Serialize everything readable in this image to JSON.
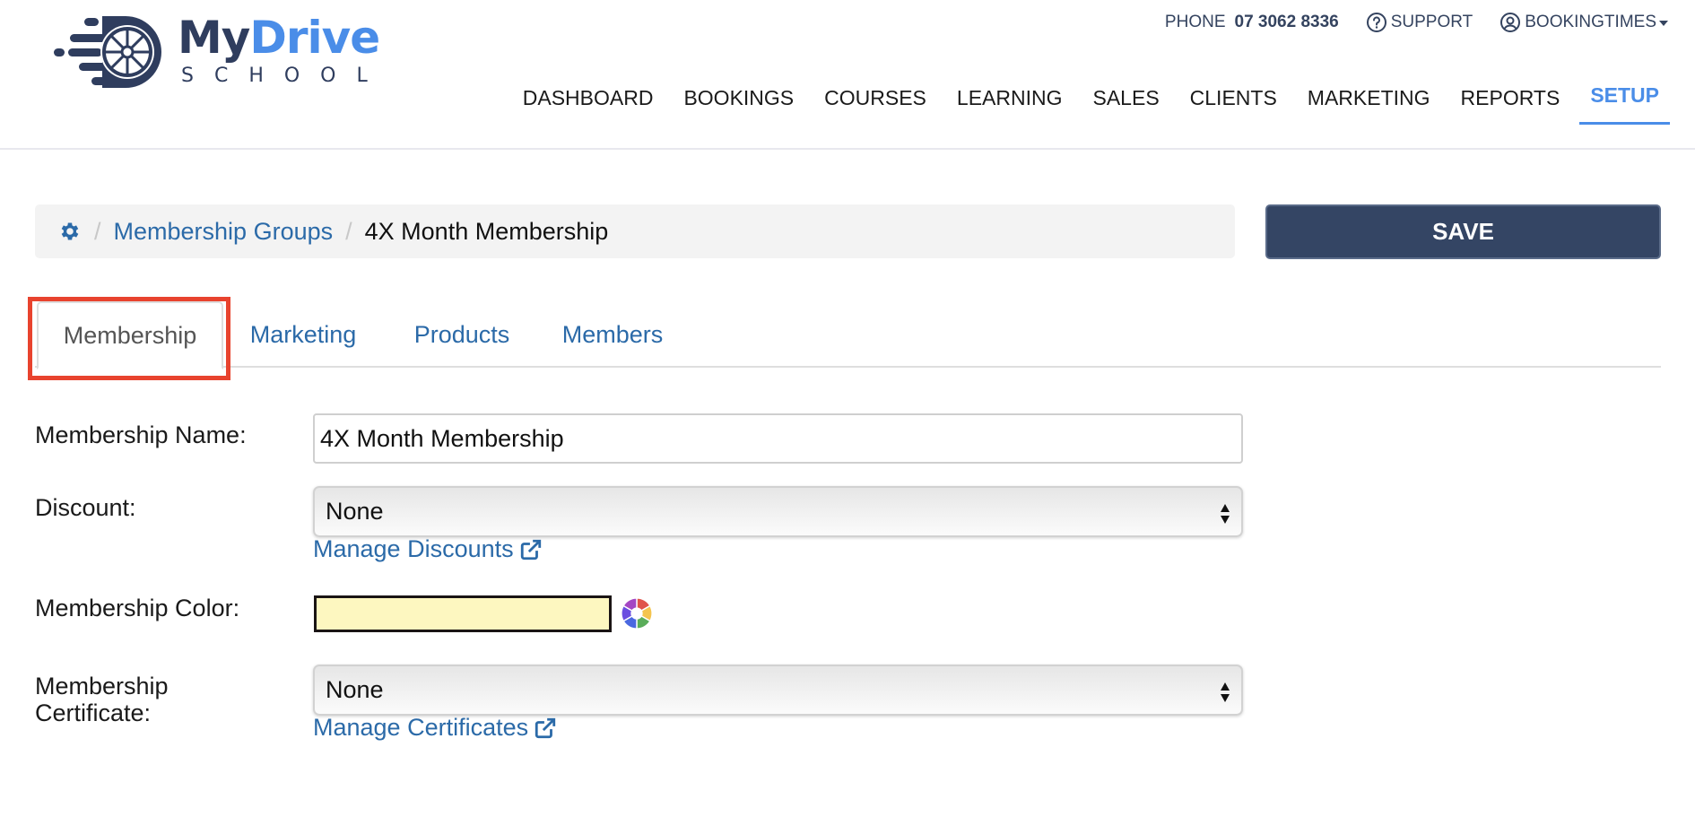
{
  "brand": {
    "name_part1": "My",
    "name_part2": "Drive",
    "subtitle": "SCHOOL",
    "logo_icon": "speeding-wheel-logo",
    "colors": {
      "primary": "#2f3d5e",
      "accent": "#4a8de8"
    }
  },
  "topbar": {
    "phone_label": "PHONE",
    "phone_number": "07 3062 8336",
    "support_label": "SUPPORT",
    "support_icon": "question-circle-icon",
    "account_label": "BOOKINGTIMES",
    "account_icon": "user-circle-icon"
  },
  "nav": {
    "items": [
      {
        "label": "DASHBOARD",
        "active": false
      },
      {
        "label": "BOOKINGS",
        "active": false
      },
      {
        "label": "COURSES",
        "active": false
      },
      {
        "label": "LEARNING",
        "active": false
      },
      {
        "label": "SALES",
        "active": false
      },
      {
        "label": "CLIENTS",
        "active": false
      },
      {
        "label": "MARKETING",
        "active": false
      },
      {
        "label": "REPORTS",
        "active": false
      },
      {
        "label": "SETUP",
        "active": true
      }
    ]
  },
  "breadcrumb": {
    "home_icon": "gear-icon",
    "separator": "/",
    "items": [
      {
        "label": "Membership Groups",
        "link": true
      },
      {
        "label": "4X Month Membership",
        "link": false
      }
    ]
  },
  "toolbar": {
    "save_label": "SAVE",
    "save_color": "#344564"
  },
  "tabs": [
    {
      "label": "Membership",
      "active": true,
      "highlighted": true
    },
    {
      "label": "Marketing",
      "active": false
    },
    {
      "label": "Products",
      "active": false
    },
    {
      "label": "Members",
      "active": false
    }
  ],
  "form": {
    "name": {
      "label": "Membership Name:",
      "value": "4X Month Membership"
    },
    "discount": {
      "label": "Discount:",
      "selected": "None",
      "manage_link": "Manage Discounts"
    },
    "color": {
      "label": "Membership Color:",
      "value": "#fdf7c0",
      "picker_icon": "color-wheel-icon"
    },
    "certificate": {
      "label_line1": "Membership",
      "label_line2": "Certificate:",
      "selected": "None",
      "manage_link": "Manage Certificates"
    }
  },
  "annotation": {
    "highlight_color": "#e8432e",
    "target": "Membership tab"
  }
}
